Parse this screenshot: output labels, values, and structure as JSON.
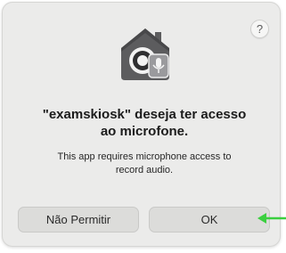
{
  "dialog": {
    "help_label": "?",
    "title_line1": "\"examskiosk\" deseja ter acesso",
    "title_line2": "ao microfone.",
    "message_line1": "This app requires microphone access to",
    "message_line2": "record audio.",
    "deny_label": "Não Permitir",
    "ok_label": "OK"
  },
  "icons": {
    "app_icon": "privacy-microphone-icon",
    "help_icon": "help-icon",
    "annotation_arrow": "green-arrow-left-icon"
  },
  "colors": {
    "dialog_background": "#ebebea",
    "button_background": "#dcdcda",
    "annotation_arrow": "#3bcf3f"
  }
}
